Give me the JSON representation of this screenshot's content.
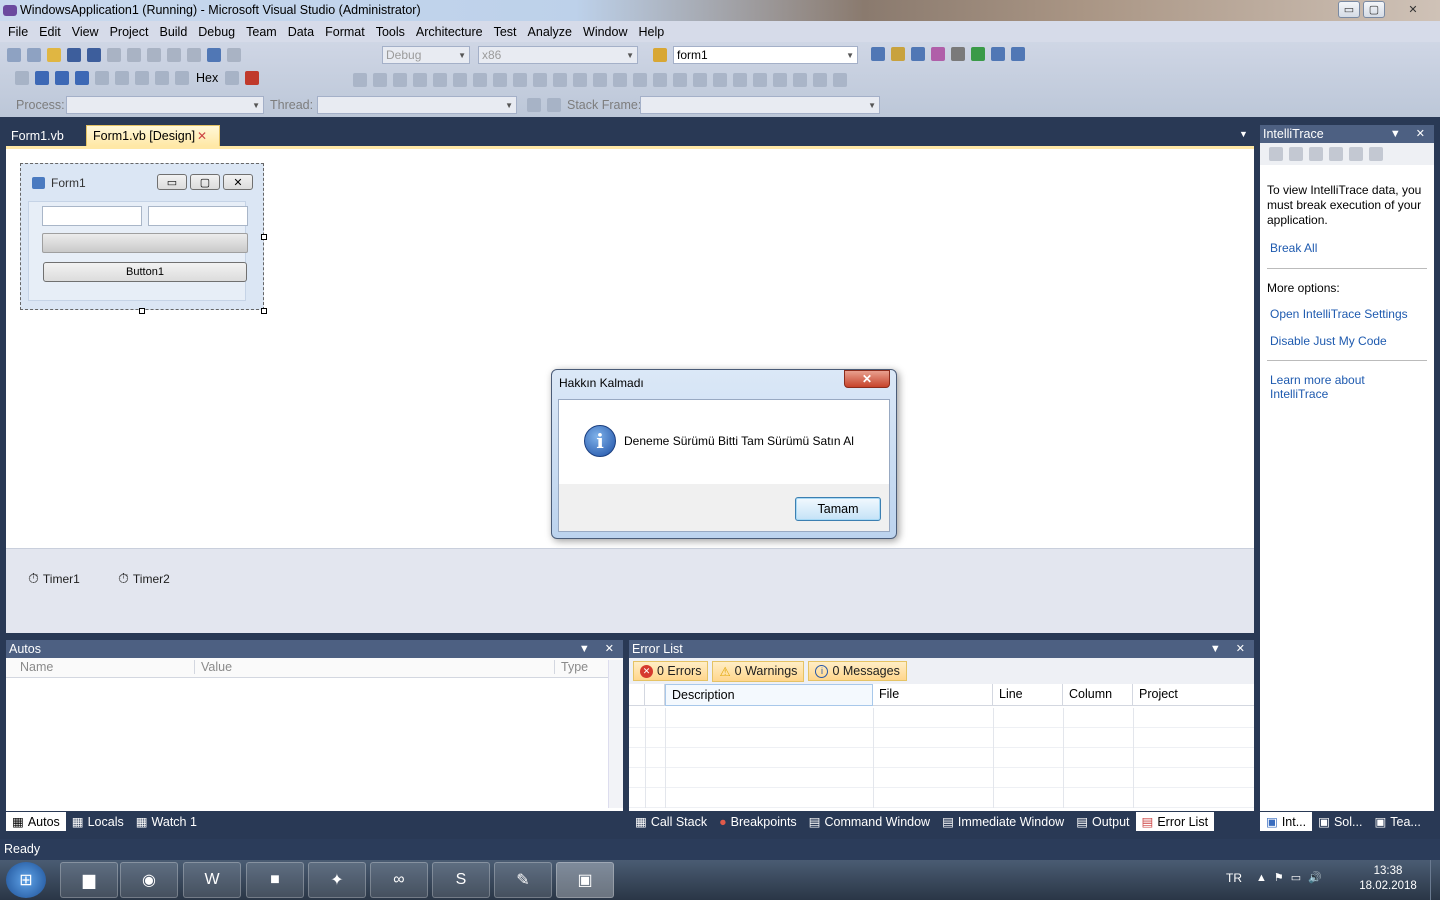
{
  "window": {
    "title": "WindowsApplication1 (Running) - Microsoft Visual Studio (Administrator)",
    "min": "▭",
    "max": "▢",
    "close": "✕"
  },
  "menu": [
    "File",
    "Edit",
    "View",
    "Project",
    "Build",
    "Debug",
    "Team",
    "Data",
    "Format",
    "Tools",
    "Architecture",
    "Test",
    "Analyze",
    "Window",
    "Help"
  ],
  "toolbar": {
    "config": "Debug",
    "platform": "x86",
    "find": "form1",
    "hex": "Hex",
    "process_label": "Process:",
    "thread_label": "Thread:",
    "stack_label": "Stack Frame:"
  },
  "doc_tabs": [
    "Form1.vb",
    "Form1.vb [Design]"
  ],
  "form1": {
    "caption": "Form1",
    "button": "Button1",
    "progress": 0
  },
  "tray": [
    "Timer1",
    "Timer2"
  ],
  "msgbox": {
    "title": "Hakkın Kalmadı",
    "close": "✕",
    "message": "Deneme Sürümü Bitti Tam Sürümü Satın Al",
    "ok": "Tamam",
    "icon": "i"
  },
  "intellitrace": {
    "title": "IntelliTrace",
    "info": "To view IntelliTrace data, you must break execution of your application.",
    "break_all": "Break All",
    "more": "More options:",
    "settings": "Open IntelliTrace Settings",
    "justmycode": "Disable Just My Code",
    "learn": "Learn more about IntelliTrace",
    "tabs": [
      "Int...",
      "Sol...",
      "Tea..."
    ]
  },
  "autos": {
    "title": "Autos",
    "cols": [
      "Name",
      "Value",
      "Type"
    ],
    "tabs": [
      "Autos",
      "Locals",
      "Watch 1"
    ]
  },
  "errorlist": {
    "title": "Error List",
    "errors": "0 Errors",
    "warnings": "0 Warnings",
    "messages": "0 Messages",
    "cols": [
      "Description",
      "File",
      "Line",
      "Column",
      "Project"
    ],
    "tabs": [
      "Call Stack",
      "Breakpoints",
      "Command Window",
      "Immediate Window",
      "Output",
      "Error List"
    ]
  },
  "status": "Ready",
  "tray_sys": {
    "lang": "TR",
    "time": "13:38",
    "date": "18.02.2018"
  }
}
